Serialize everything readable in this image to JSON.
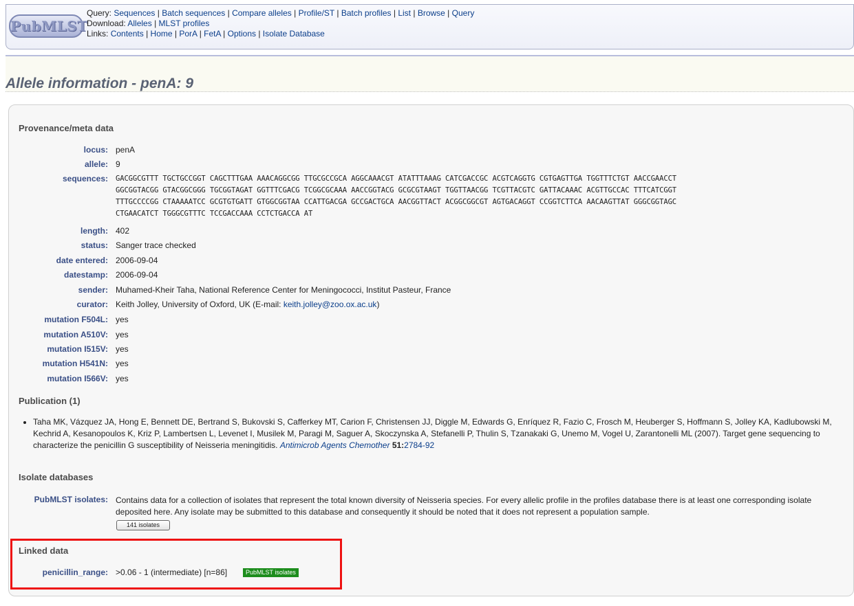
{
  "header": {
    "logo": "PubMLST",
    "query_label": "Query:",
    "query_links": [
      "Sequences",
      "Batch sequences",
      "Compare alleles",
      "Profile/ST",
      "Batch profiles",
      "List",
      "Browse",
      "Query"
    ],
    "download_label": "Download:",
    "download_links": [
      "Alleles",
      "MLST profiles"
    ],
    "links_label": "Links:",
    "links_links": [
      "Contents",
      "Home",
      "PorA",
      "FetA",
      "Options",
      "Isolate Database"
    ]
  },
  "page_title": "Allele information - penA: 9",
  "provenance": {
    "heading": "Provenance/meta data",
    "fields": [
      {
        "label": "locus:",
        "value": "penA"
      },
      {
        "label": "allele:",
        "value": "9"
      },
      {
        "label": "sequences:",
        "value": ""
      },
      {
        "label": "length:",
        "value": "402"
      },
      {
        "label": "status:",
        "value": "Sanger trace checked"
      },
      {
        "label": "date entered:",
        "value": "2006-09-04"
      },
      {
        "label": "datestamp:",
        "value": "2006-09-04"
      },
      {
        "label": "sender:",
        "value": "Muhamed-Kheir Taha, National Reference Center for Meningococci, Institut Pasteur, France"
      },
      {
        "label": "curator:",
        "value": "Keith Jolley, University of Oxford, UK (E-mail: "
      },
      {
        "label": "mutation F504L:",
        "value": "yes"
      },
      {
        "label": "mutation A510V:",
        "value": "yes"
      },
      {
        "label": "mutation I515V:",
        "value": "yes"
      },
      {
        "label": "mutation H541N:",
        "value": "yes"
      },
      {
        "label": "mutation I566V:",
        "value": "yes"
      }
    ],
    "curator_email": "keith.jolley@zoo.ox.ac.uk",
    "curator_close": ")",
    "sequence_lines": [
      "GACGGCGTTT TGCTGCCGGT CAGCTTTGAA AAACAGGCGG TTGCGCCGCA AGGCAAACGT ATATTTAAAG CATCGACCGC ACGTCAGGTG CGTGAGTTGA TGGTTTCTGT AACCGAACCT",
      "GGCGGTACGG GTACGGCGGG TGCGGTAGAT GGTTTCGACG TCGGCGCAAA AACCGGTACG GCGCGTAAGT TGGTTAACGG TCGTTACGTC GATTACAAAC ACGTTGCCAC TTTCATCGGT",
      "TTTGCCCCGG CTAAAAATCC GCGTGTGATT GTGGCGGTAA CCATTGACGA GCCGACTGCA AACGGTTACT ACGGCGGCGT AGTGACAGGT CCGGTCTTCA AACAAGTTAT GGGCGGTAGC",
      "CTGAACATCT TGGGCGTTTC TCCGACCAAA CCTCTGACCA AT"
    ]
  },
  "publication": {
    "heading": "Publication (1)",
    "authors_text": "Taha MK, Vázquez JA, Hong E, Bennett DE, Bertrand S, Bukovski S, Cafferkey MT, Carion F, Christensen JJ, Diggle M, Edwards G, Enríquez R, Fazio C, Frosch M, Heuberger S, Hoffmann S, Jolley KA, Kadlubowski M, Kechrid A, Kesanopoulos K, Kriz P, Lambertsen L, Levenet I, Musilek M, Paragi M, Saguer A, Skoczynska A, Stefanelli P, Thulin S, Tzanakaki G, Unemo M, Vogel U, Zarantonelli ML (2007). Target gene sequencing to characterize the penicillin G susceptibility of Neisseria meningitidis. ",
    "journal": "Antimicrob Agents Chemother",
    "volume": "51:",
    "pages": "2784-92"
  },
  "isolate_databases": {
    "heading": "Isolate databases",
    "label": "PubMLST isolates:",
    "description": "Contains data for a collection of isolates that represent the total known diversity of Neisseria species. For every allelic profile in the profiles database there is at least one corresponding isolate deposited here. Any isolate may be submitted to this database and consequently it should be noted that it does not represent a population sample.",
    "button": "141 isolates"
  },
  "linked_data": {
    "heading": "Linked data",
    "label": "penicillin_range:",
    "value": ">0.06 - 1 (intermediate) [n=86]",
    "badge": "PubMLST isolates"
  },
  "colors": {
    "highlight": "#ee1111",
    "badge": "#1d8d1d",
    "label": "#3a4f86"
  }
}
